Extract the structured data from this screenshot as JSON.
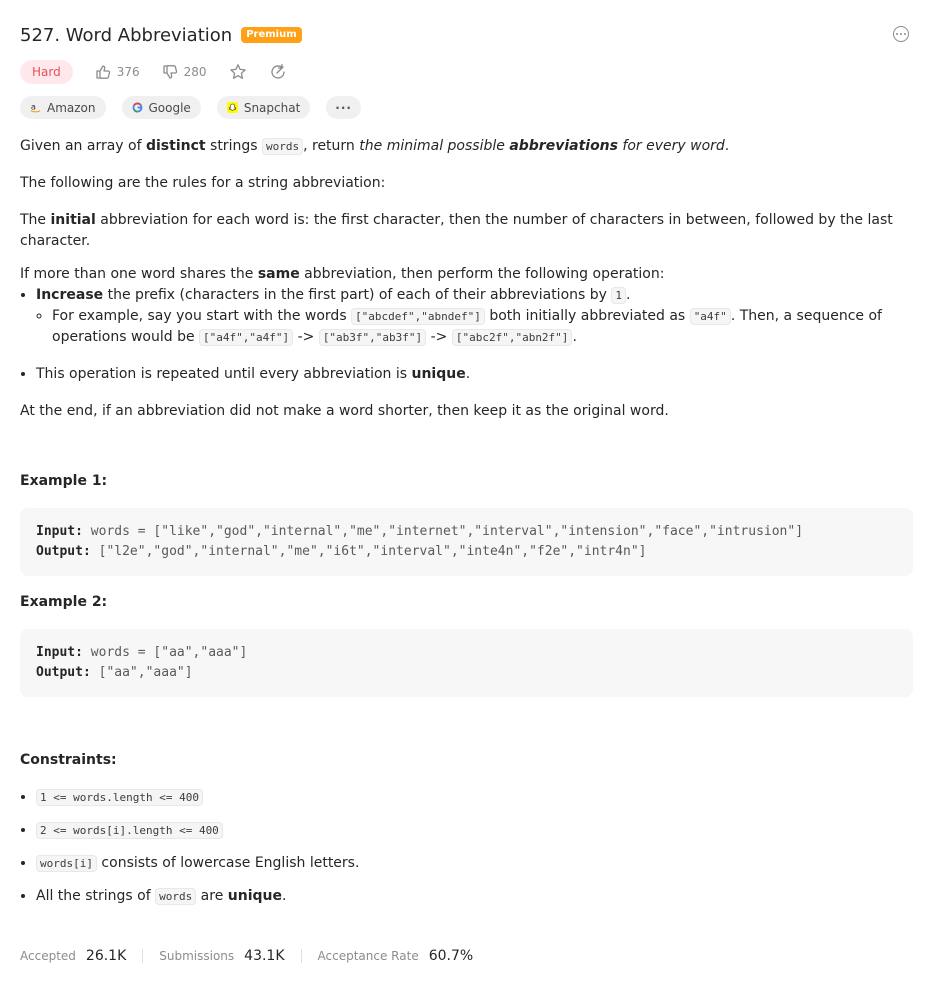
{
  "header": {
    "title": "527. Word Abbreviation",
    "premium_badge": "Premium"
  },
  "meta": {
    "difficulty": "Hard",
    "likes": "376",
    "dislikes": "280"
  },
  "tags": [
    {
      "label": "Amazon"
    },
    {
      "label": "Google"
    },
    {
      "label": "Snapchat"
    },
    {
      "label": "···"
    }
  ],
  "description": {
    "p1": {
      "a": "Given an array of ",
      "b": "distinct",
      "c": " strings ",
      "code": "words",
      "d": ", return ",
      "e": "the minimal possible ",
      "f": "abbreviations",
      "g": " for every word",
      "h": "."
    },
    "p2": "The following are the rules for a string abbreviation:",
    "p3": {
      "a": "The ",
      "b": "initial",
      "c": " abbreviation for each word is: the first character, then the number of characters in between, followed by the last character."
    },
    "p4": {
      "a": "If more than one word shares the ",
      "b": "same",
      "c": " abbreviation, then perform the following operation:"
    },
    "bullet1": {
      "a": "Increase",
      "b": " the prefix (characters in the first part) of each of their abbreviations by ",
      "code": "1",
      "c": "."
    },
    "sub1": {
      "a": "For example, say you start with the words ",
      "code1": "[\"abcdef\",\"abndef\"]",
      "b": " both initially abbreviated as ",
      "code2": "\"a4f\"",
      "c": ". Then, a sequence of operations would be ",
      "code3": "[\"a4f\",\"a4f\"]",
      "arrow1": " -> ",
      "code4": "[\"ab3f\",\"ab3f\"]",
      "arrow2": " -> ",
      "code5": "[\"abc2f\",\"abn2f\"]",
      "d": "."
    },
    "bullet2": {
      "a": "This operation is repeated until every abbreviation is ",
      "b": "unique",
      "c": "."
    },
    "p5": "At the end, if an abbreviation did not make a word shorter, then keep it as the original word."
  },
  "examples": [
    {
      "title": "Example 1:",
      "input_label": "Input:",
      "input": "words = [\"like\",\"god\",\"internal\",\"me\",\"internet\",\"interval\",\"intension\",\"face\",\"intrusion\"]",
      "output_label": "Output:",
      "output": "[\"l2e\",\"god\",\"internal\",\"me\",\"i6t\",\"interval\",\"inte4n\",\"f2e\",\"intr4n\"]"
    },
    {
      "title": "Example 2:",
      "input_label": "Input:",
      "input": "words = [\"aa\",\"aaa\"]",
      "output_label": "Output:",
      "output": "[\"aa\",\"aaa\"]"
    }
  ],
  "constraints": {
    "title": "Constraints:",
    "c1": "1 <= words.length <= 400",
    "c2": "2 <= words[i].length <= 400",
    "c3_code": "words[i]",
    "c3_text": " consists of lowercase English letters.",
    "c4_a": "All the strings of ",
    "c4_code": "words",
    "c4_b": " are ",
    "c4_c": "unique",
    "c4_d": "."
  },
  "stats": {
    "accepted_label": "Accepted",
    "accepted": "26.1K",
    "submissions_label": "Submissions",
    "submissions": "43.1K",
    "rate_label": "Acceptance Rate",
    "rate": "60.7%"
  },
  "colors": {
    "premium": "#ffa116",
    "hard": "#e8505b",
    "hard_bg": "#ffe8eb"
  },
  "icons": [
    "thumbs-up-icon",
    "thumbs-down-icon",
    "star-icon",
    "share-icon",
    "more-icon",
    "amazon-icon",
    "google-icon",
    "snapchat-icon"
  ]
}
